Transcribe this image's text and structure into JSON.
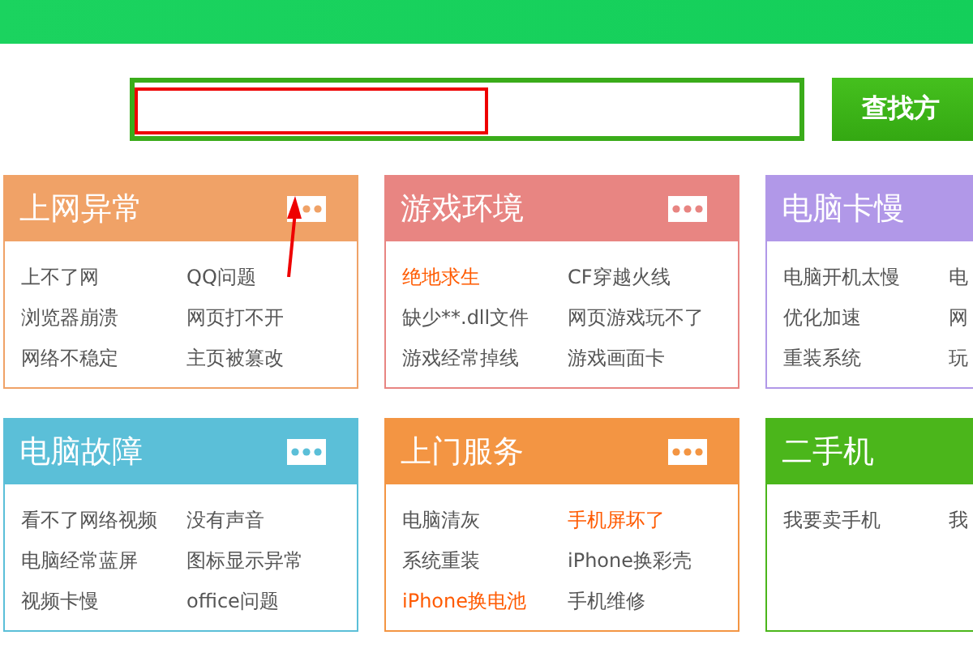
{
  "search": {
    "button": "查找方"
  },
  "categories": [
    {
      "title": "上网异常",
      "color": "#f0a267",
      "has_more": true,
      "items": [
        {
          "label": "上不了网",
          "hot": false
        },
        {
          "label": "QQ问题",
          "hot": false
        },
        {
          "label": "浏览器崩溃",
          "hot": false
        },
        {
          "label": "网页打不开",
          "hot": false
        },
        {
          "label": "网络不稳定",
          "hot": false
        },
        {
          "label": "主页被篡改",
          "hot": false
        }
      ]
    },
    {
      "title": "游戏环境",
      "color": "#e88582",
      "has_more": true,
      "items": [
        {
          "label": "绝地求生",
          "hot": true
        },
        {
          "label": "CF穿越火线",
          "hot": false
        },
        {
          "label": "缺少**.dll文件",
          "hot": false
        },
        {
          "label": "网页游戏玩不了",
          "hot": false
        },
        {
          "label": "游戏经常掉线",
          "hot": false
        },
        {
          "label": "游戏画面卡",
          "hot": false
        }
      ]
    },
    {
      "title": "电脑卡慢",
      "color": "#b198e8",
      "items": [
        {
          "label": "电脑开机太慢",
          "hot": false
        },
        {
          "label": "电",
          "hot": false
        },
        {
          "label": "优化加速",
          "hot": false
        },
        {
          "label": "网",
          "hot": false
        },
        {
          "label": "重装系统",
          "hot": false
        },
        {
          "label": "玩",
          "hot": false
        }
      ]
    },
    {
      "title": "电脑故障",
      "color": "#5bbfd8",
      "has_more": true,
      "items": [
        {
          "label": "看不了网络视频",
          "hot": false
        },
        {
          "label": "没有声音",
          "hot": false
        },
        {
          "label": "电脑经常蓝屏",
          "hot": false
        },
        {
          "label": "图标显示异常",
          "hot": false
        },
        {
          "label": "视频卡慢",
          "hot": false
        },
        {
          "label": "office问题",
          "hot": false
        }
      ]
    },
    {
      "title": "上门服务",
      "color": "#f39543",
      "has_more": true,
      "items": [
        {
          "label": "电脑清灰",
          "hot": false
        },
        {
          "label": "手机屏坏了",
          "hot": true
        },
        {
          "label": "系统重装",
          "hot": false
        },
        {
          "label": "iPhone换彩壳",
          "hot": false
        },
        {
          "label": "iPhone换电池",
          "hot": true
        },
        {
          "label": "手机维修",
          "hot": false
        }
      ]
    },
    {
      "title": "二手机",
      "color": "#4bb61b",
      "items": [
        {
          "label": "我要卖手机",
          "hot": false
        },
        {
          "label": "我",
          "hot": false
        }
      ]
    }
  ]
}
